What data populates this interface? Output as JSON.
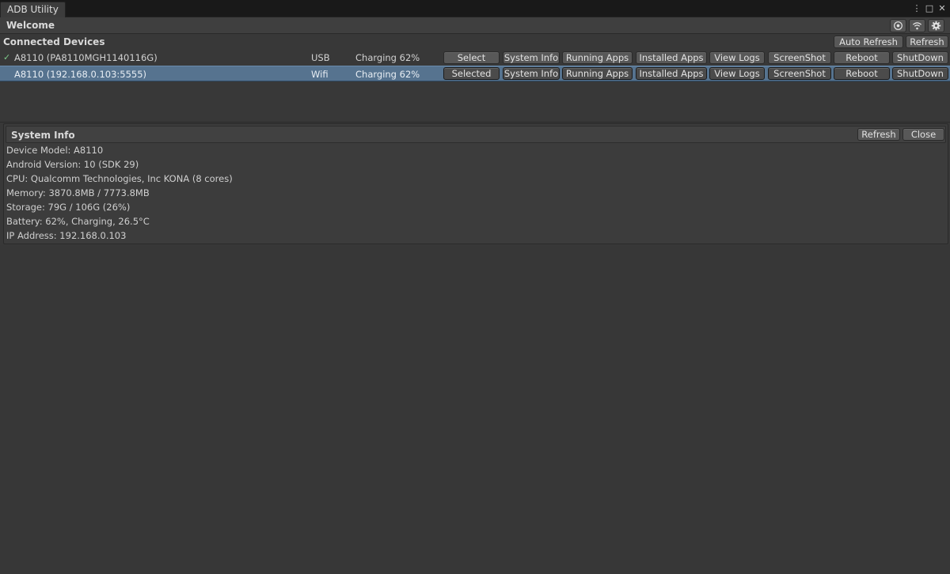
{
  "window": {
    "tab_title": "ADB Utility",
    "controls": {
      "menu": "⋮",
      "maximize": "□",
      "close": "✕"
    }
  },
  "welcome": {
    "label": "Welcome",
    "icons": [
      "target-icon",
      "wifi-icon",
      "gear-icon"
    ]
  },
  "devices": {
    "title": "Connected Devices",
    "auto_refresh_label": "Auto Refresh",
    "refresh_label": "Refresh",
    "rows": [
      {
        "check": "✓",
        "name": "A8110 (PA8110MGH1140116G)",
        "connection": "USB",
        "status": "Charging 62%",
        "select_label": "Select",
        "sysinfo_label": "System Info",
        "running_label": "Running Apps",
        "installed_label": "Installed Apps",
        "logs_label": "View Logs",
        "screenshot_label": "ScreenShot",
        "reboot_label": "Reboot",
        "shutdown_label": "ShutDown"
      },
      {
        "check": "",
        "name": "A8110 (192.168.0.103:5555)",
        "connection": "Wifi",
        "status": "Charging 62%",
        "select_label": "Selected",
        "sysinfo_label": "System Info",
        "running_label": "Running Apps",
        "installed_label": "Installed Apps",
        "logs_label": "View Logs",
        "screenshot_label": "ScreenShot",
        "reboot_label": "Reboot",
        "shutdown_label": "ShutDown"
      }
    ]
  },
  "sysinfo": {
    "title": "System Info",
    "refresh_label": "Refresh",
    "close_label": "Close",
    "lines": [
      "Device Model: A8110",
      "Android Version: 10 (SDK 29)",
      "CPU: Qualcomm Technologies, Inc KONA (8 cores)",
      "Memory: 3870.8MB / 7773.8MB",
      "Storage: 79G / 106G (26%)",
      "Battery: 62%, Charging, 26.5°C",
      "IP Address: 192.168.0.103"
    ]
  },
  "colors": {
    "background": "#383838",
    "selected_row": "#56738f",
    "check": "#7ec98a"
  }
}
